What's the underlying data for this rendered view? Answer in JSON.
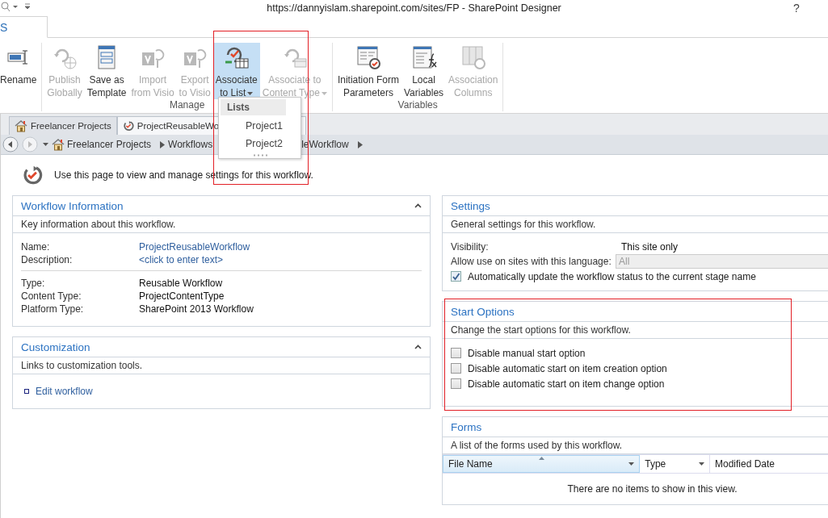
{
  "title_bar": {
    "title": "https://dannyislam.sharepoint.com/sites/FP - SharePoint Designer",
    "help": "?"
  },
  "ribbon_tabs": [
    {
      "label": "S",
      "selected": true
    }
  ],
  "ribbon_groups": [
    {
      "buttons": [
        {
          "kind": "rename",
          "label": "Rename",
          "disabled": false,
          "selected": false,
          "dropdown": false
        }
      ]
    },
    {
      "label": "Manage",
      "buttons": [
        {
          "kind": "publish",
          "label": "Publish\nGlobally",
          "disabled": true,
          "selected": false,
          "dropdown": false
        },
        {
          "kind": "template",
          "label": "Save as\nTemplate",
          "disabled": false,
          "selected": false,
          "dropdown": false
        },
        {
          "kind": "import",
          "label": "Import\nfrom Visio",
          "disabled": true,
          "selected": false,
          "dropdown": false
        },
        {
          "kind": "export",
          "label": "Export\nto Visio",
          "disabled": true,
          "selected": false,
          "dropdown": false
        },
        {
          "kind": "list",
          "label": "Associate\nto List",
          "disabled": false,
          "selected": true,
          "dropdown": true
        },
        {
          "kind": "ctype",
          "label": "Associate to\nContent Type",
          "disabled": true,
          "selected": false,
          "dropdown": true
        }
      ]
    },
    {
      "label": "Variables",
      "buttons": [
        {
          "kind": "form",
          "label": "Initiation Form\nParameters",
          "disabled": false,
          "selected": false,
          "dropdown": false
        },
        {
          "kind": "variables",
          "label": "Local\nVariables",
          "disabled": false,
          "selected": false,
          "dropdown": false
        },
        {
          "kind": "columns",
          "label": "Association\nColumns",
          "disabled": true,
          "selected": false,
          "dropdown": false
        }
      ]
    }
  ],
  "menu": {
    "header": "Lists",
    "items": [
      "Project1",
      "Project2"
    ],
    "highlighted": true
  },
  "doc_tabs": [
    {
      "kind": "site",
      "label": "Freelancer Projects",
      "selected": false
    },
    {
      "kind": "workflow",
      "label": "ProjectReusableWo",
      "selected": true
    }
  ],
  "breadcrumb": [
    {
      "kind": "site",
      "label": "Freelancer Projects",
      "arrow": true
    },
    {
      "kind": "page",
      "label": "Workflows",
      "arrow": false
    },
    {
      "kind": "page",
      "label": "leWorkflow",
      "arrow": true
    }
  ],
  "intro": "Use this page to view and manage settings for this workflow.",
  "left_panels": [
    {
      "kind": "info",
      "title": "Workflow Information",
      "description": "Key information about this workflow.",
      "collapsible": true,
      "highlighted": false,
      "groups": [
        [
          {
            "label": "Name:",
            "value": "ProjectReusableWorkflow",
            "link": true
          },
          {
            "label": "Description:",
            "value": "<click to enter text>",
            "link": true
          }
        ],
        [
          {
            "label": "Type:",
            "value": "Reusable Workflow",
            "link": false
          },
          {
            "label": "Content Type:",
            "value": "ProjectContentType",
            "link": false
          },
          {
            "label": "Platform Type:",
            "value": "SharePoint 2013 Workflow",
            "link": false
          }
        ]
      ]
    },
    {
      "kind": "links",
      "title": "Customization",
      "description": "Links to customization tools.",
      "collapsible": true,
      "highlighted": false,
      "links": [
        "Edit workflow"
      ]
    }
  ],
  "right_panels": [
    {
      "kind": "settings",
      "title": "Settings",
      "description": "General settings for this workflow.",
      "highlighted": false,
      "fields": [
        {
          "label": "Visibility:",
          "value": "This site only"
        }
      ],
      "select": {
        "label": "Allow use on sites with this language:",
        "value": "All",
        "disabled": true
      },
      "checkboxes": [
        {
          "label": "Automatically update the workflow status to the current stage name",
          "checked": true
        }
      ]
    },
    {
      "kind": "options",
      "title": "Start Options",
      "description": "Change the start options for this workflow.",
      "highlighted": true,
      "checkboxes": [
        {
          "label": "Disable manual start option",
          "checked": false
        },
        {
          "label": "Disable automatic start on item creation option",
          "checked": false
        },
        {
          "label": "Disable automatic start on item change option",
          "checked": false
        }
      ]
    },
    {
      "kind": "table",
      "title": "Forms",
      "description": "A list of the forms used by this workflow.",
      "highlighted": false,
      "columns": [
        {
          "label": "File Name",
          "sorted": true,
          "filter": true
        },
        {
          "label": "Type",
          "sorted": false,
          "filter": true
        },
        {
          "label": "Modified Date",
          "sorted": false
        }
      ],
      "empty": "There are no items to show in this view."
    }
  ]
}
